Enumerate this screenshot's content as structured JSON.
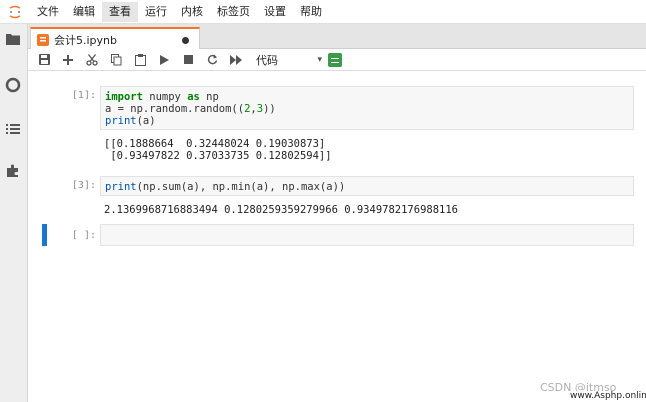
{
  "menu": {
    "items": [
      "文件",
      "编辑",
      "查看",
      "运行",
      "内核",
      "标签页",
      "设置",
      "帮助"
    ],
    "active_index": 2
  },
  "tab": {
    "title": "会计5.ipynb",
    "modified": true
  },
  "toolbar": {
    "cell_type": "代码",
    "icons": [
      "save-icon",
      "add-icon",
      "cut-icon",
      "copy-icon",
      "paste-icon",
      "run-icon",
      "stop-icon",
      "restart-icon",
      "fast-forward-icon"
    ]
  },
  "cells": [
    {
      "prompt": "[1]:",
      "code": [
        "import numpy as np",
        "a = np.random.random((2,3))",
        "print(a)"
      ],
      "output": [
        "[[0.1888664  0.32448024 0.19030873]",
        " [0.93497822 0.37033735 0.12802594]]"
      ]
    },
    {
      "prompt": "[3]:",
      "code": [
        "print(np.sum(a), np.min(a), np.max(a))"
      ],
      "output": [
        "2.1369968716883494 0.1280259359279966 0.9349782176988116"
      ]
    },
    {
      "prompt": "[ ]:",
      "code": [],
      "output": []
    }
  ],
  "watermark": {
    "text": "CSDN @itmso",
    "site": "www.Asphp.online"
  },
  "colors": {
    "accent_orange": "#f37726",
    "active_blue": "#1976d2",
    "keyword_green": "#008000"
  }
}
